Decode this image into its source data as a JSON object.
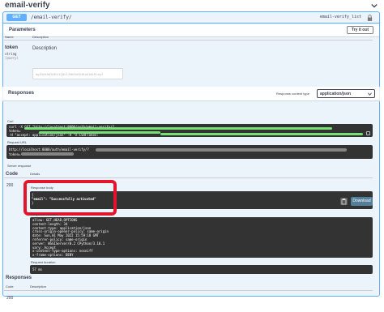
{
  "section": {
    "title": "email-verify"
  },
  "operation": {
    "method": "GET",
    "path": "/email-verify/",
    "operation_id": "email-verify_list"
  },
  "parameters": {
    "title": "Parameters",
    "try_it_out": "Try it out",
    "col_name": "Name",
    "col_description": "Description",
    "param_name": "token",
    "param_type": "string",
    "param_in": "(query)",
    "param_description": "Description",
    "param_value": "eyJ0eXAiOiJKV1QiLCJhbGciOiJIUzI1NiJ9.eyJ"
  },
  "responses": {
    "title": "Responses",
    "content_type_label": "Response content type",
    "content_type_value": "application/json",
    "curl_label": "Curl",
    "curl_line1": "curl -X GET \"http://localhost:8000/auth/email-verify/?",
    "curl_line2": "token=",
    "curl_line3": "  -H  \"accept: application/json\" -H  \"X-CSRFToken:",
    "request_url_label": "Request URL",
    "request_url_line1": "http://localhost:8000/auth/email-verify/?",
    "request_url_line2": "token=",
    "server_response_label": "Server response",
    "code_header": "Code",
    "details_header": "Details",
    "code_value": "200",
    "response_body_label": "Response body",
    "response_body_lines": [
      "{",
      "  \"email\": \"Successfully activated\"",
      "}"
    ],
    "download_label": "Download",
    "response_headers_label": "Response headers",
    "response_headers_lines": [
      "allow: GET,HEAD,OPTIONS",
      "content-length: 34",
      "content-type: application/json",
      "cross-origin-opener-policy: same-origin",
      "date: Sun,01 May 2022 15:59:18 GMT",
      "referrer-policy: same-origin",
      "server: WSGIServer/0.2 CPython/3.10.1",
      "vary: Accept",
      "x-content-type-options: nosniff",
      "x-frame-options: DENY"
    ],
    "request_duration_label": "Request duration",
    "request_duration_value": "57 ms"
  },
  "bottom_responses": {
    "title": "Responses",
    "code_header": "Code",
    "description_header": "Description",
    "code_value": "200"
  },
  "colors": {
    "method_get": "#61affe",
    "highlight_ring": "#e3152c",
    "download_button": "#547f9a",
    "redaction_green": "#7cf47c"
  }
}
